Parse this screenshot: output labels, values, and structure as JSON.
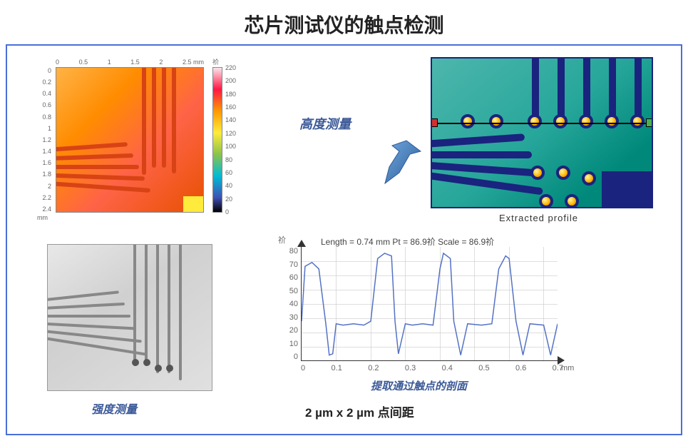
{
  "title": "芯片测试仪的触点检测",
  "heatmap": {
    "x_ticks": [
      "0",
      "0.5",
      "1",
      "1.5",
      "2",
      "2.5 mm"
    ],
    "y_ticks": [
      "0",
      "0.2",
      "0.4",
      "0.6",
      "0.8",
      "1",
      "1.2",
      "1.4",
      "1.6",
      "1.8",
      "2",
      "2.2",
      "2.4"
    ],
    "y_unit": "mm",
    "colorbar_title": "祄",
    "colorbar_ticks": [
      "220",
      "200",
      "180",
      "160",
      "140",
      "120",
      "100",
      "80",
      "60",
      "40",
      "20",
      "0"
    ]
  },
  "labels": {
    "height_measure": "高度测量",
    "intensity_measure": "强度测量",
    "extracted_profile": "Extracted profile",
    "profile_caption": "提取通过触点的剖面",
    "spacing": "2 µm x 2 µm 点间距"
  },
  "profile": {
    "header": "Length = 0.74 mm   Pt = 86.9祄   Scale = 86.9祄",
    "y_label": "祄",
    "y_ticks": [
      "80",
      "70",
      "60",
      "50",
      "40",
      "30",
      "20",
      "10",
      "0"
    ],
    "x_ticks": [
      "0",
      "0.1",
      "0.2",
      "0.3",
      "0.4",
      "0.5",
      "0.6",
      "0.7"
    ],
    "x_unit": "mm"
  },
  "chart_data": {
    "type": "line",
    "title": "Extracted profile",
    "xlabel": "mm",
    "ylabel": "祄",
    "xlim": [
      0,
      0.74
    ],
    "ylim": [
      0,
      86.9
    ],
    "annotations": {
      "Length": "0.74 mm",
      "Pt": "86.9祄",
      "Scale": "86.9祄"
    },
    "x": [
      0,
      0.01,
      0.03,
      0.05,
      0.07,
      0.08,
      0.09,
      0.1,
      0.12,
      0.15,
      0.18,
      0.2,
      0.22,
      0.24,
      0.26,
      0.27,
      0.28,
      0.3,
      0.32,
      0.35,
      0.38,
      0.4,
      0.41,
      0.43,
      0.44,
      0.46,
      0.48,
      0.52,
      0.55,
      0.57,
      0.59,
      0.6,
      0.62,
      0.64,
      0.66,
      0.7,
      0.72,
      0.74
    ],
    "y": [
      30,
      72,
      75,
      70,
      28,
      4,
      5,
      28,
      27,
      28,
      27,
      30,
      78,
      82,
      80,
      30,
      5,
      28,
      27,
      28,
      27,
      70,
      82,
      78,
      30,
      4,
      28,
      27,
      28,
      70,
      80,
      78,
      30,
      4,
      28,
      27,
      4,
      28
    ]
  }
}
